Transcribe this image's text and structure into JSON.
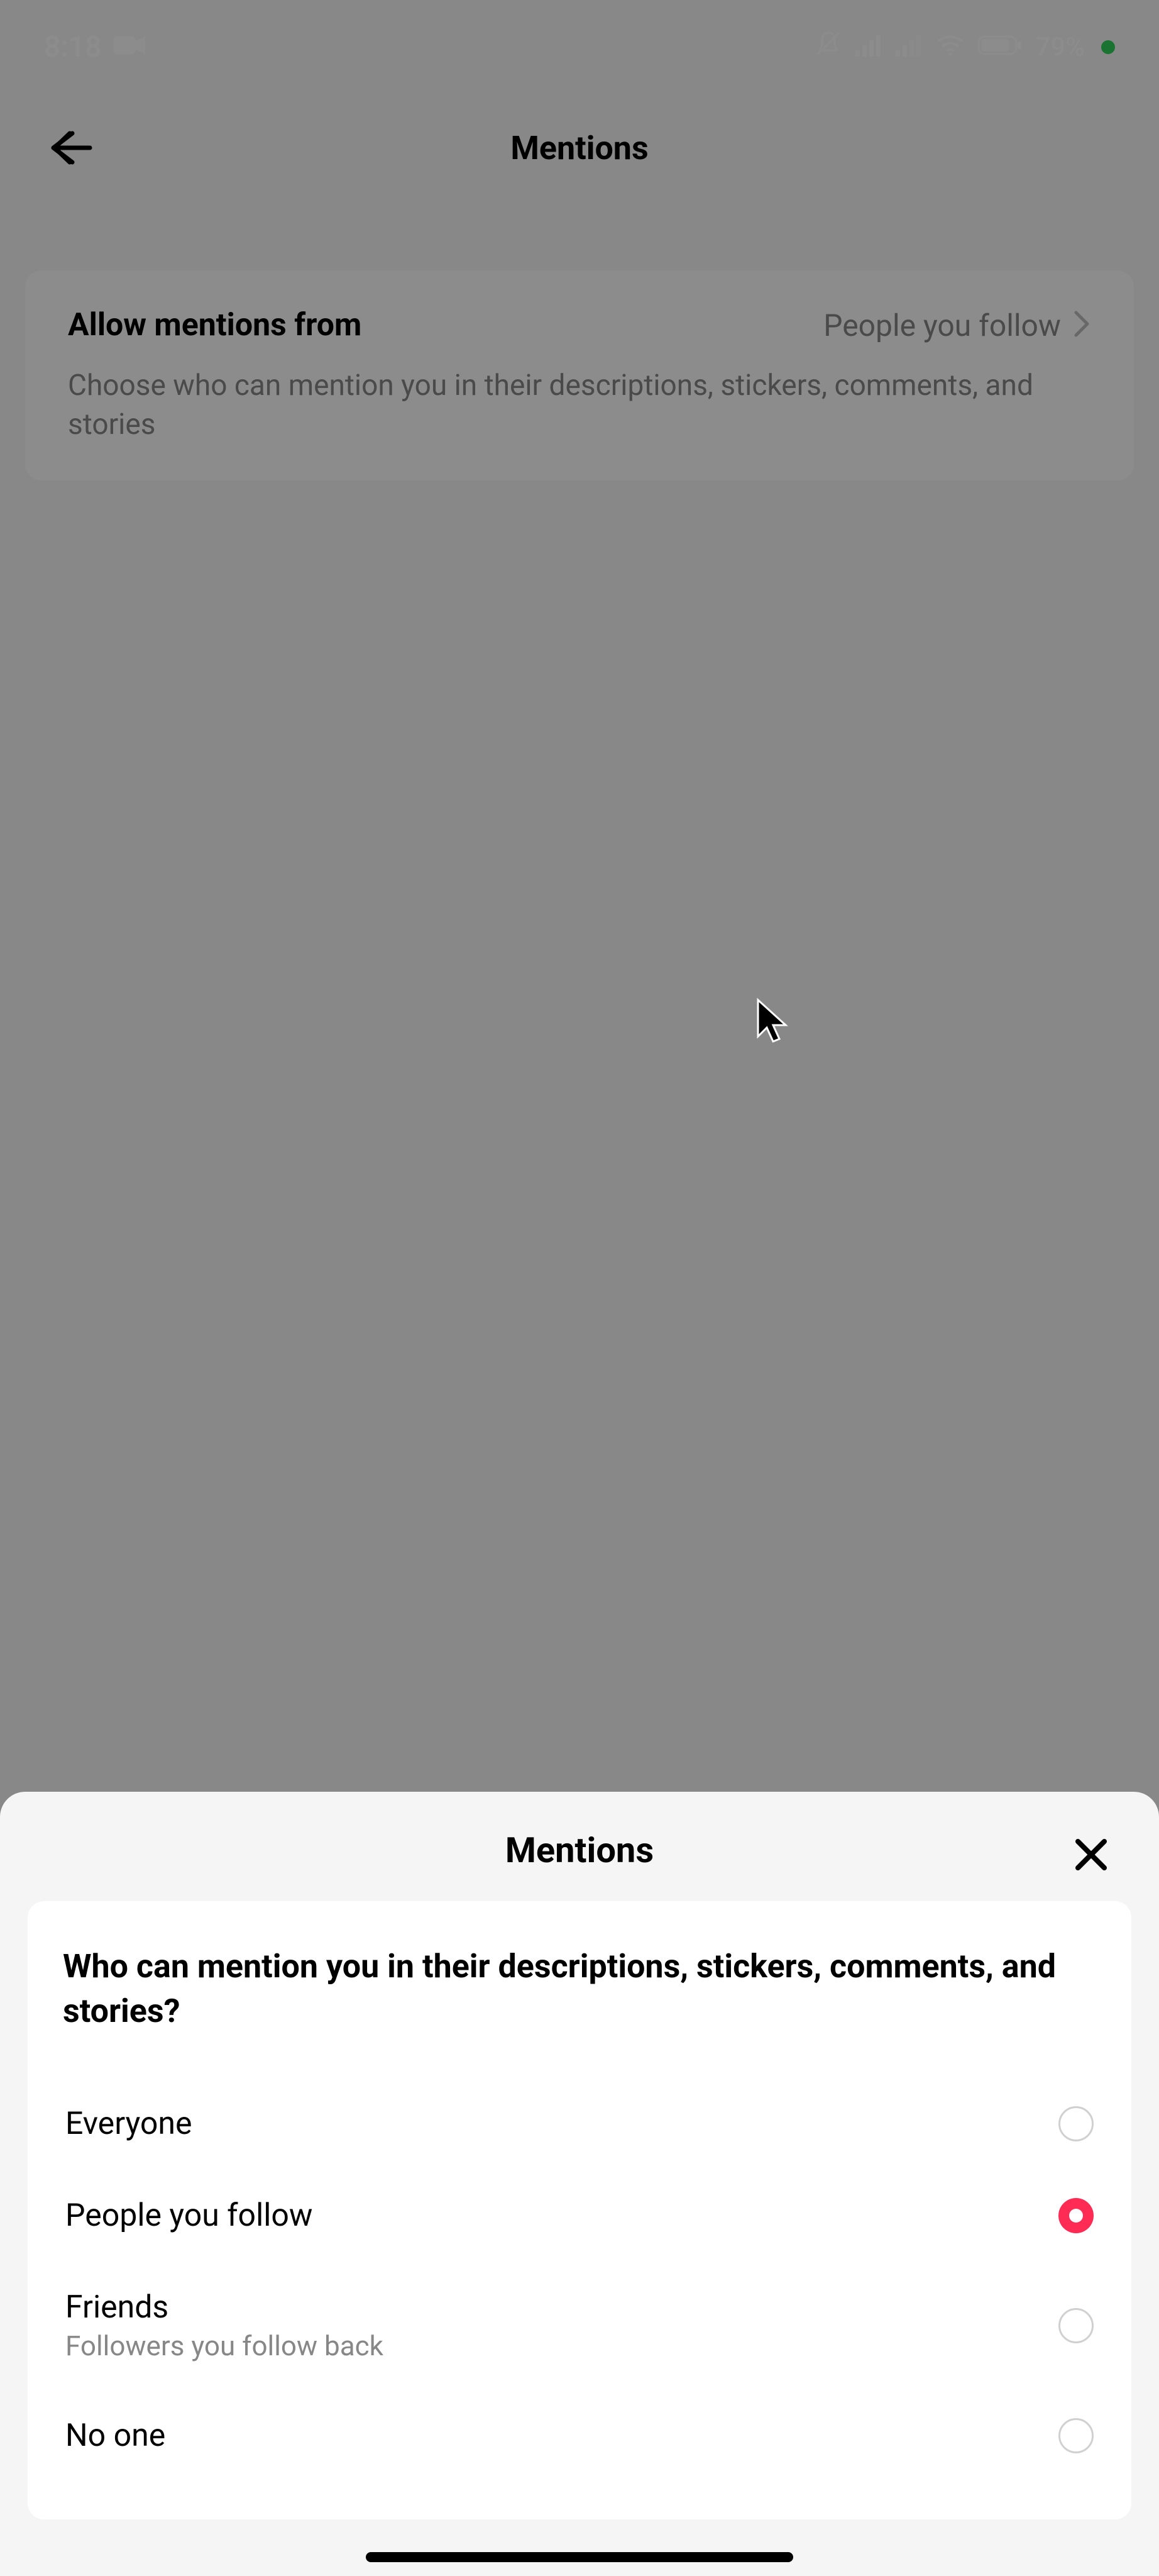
{
  "status": {
    "time": "8:18",
    "battery": "79%"
  },
  "nav": {
    "title": "Mentions"
  },
  "setting": {
    "label": "Allow mentions from",
    "value": "People you follow",
    "description": "Choose who can mention you in their descriptions, stickers, comments, and stories"
  },
  "sheet": {
    "title": "Mentions",
    "question": "Who can mention you in their descriptions, stickers, comments, and stories?",
    "options": [
      {
        "label": "Everyone",
        "sub": "",
        "selected": false
      },
      {
        "label": "People you follow",
        "sub": "",
        "selected": true
      },
      {
        "label": "Friends",
        "sub": "Followers you follow back",
        "selected": false
      },
      {
        "label": "No one",
        "sub": "",
        "selected": false
      }
    ]
  }
}
